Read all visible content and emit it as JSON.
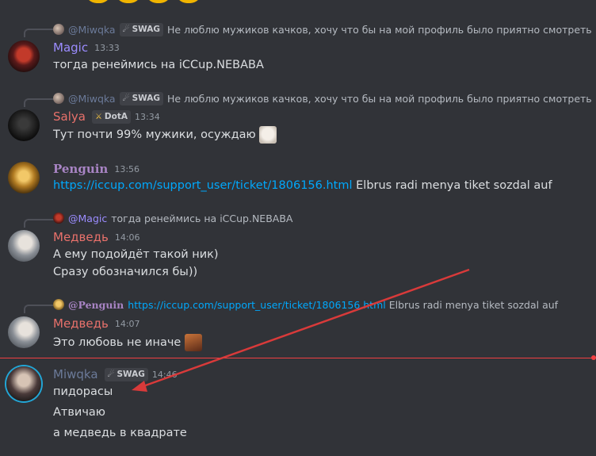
{
  "messages": [
    {
      "reply": {
        "author": "@Miwqka",
        "tag": "SWAG",
        "text": "Не люблю мужиков качков, хочу что бы на мой профиль было приятно смотреть"
      },
      "author": "Magic",
      "author_color": "#9b8cff",
      "time": "13:33",
      "lines": [
        "тогда ренеймись на iCCup.NEBABA"
      ]
    },
    {
      "reply": {
        "author": "@Miwqka",
        "tag": "SWAG",
        "text": "Не люблю мужиков качков, хочу что бы на мой профиль было приятно смотреть"
      },
      "author": "Salya",
      "author_color": "#e8716b",
      "tag": "DotA",
      "time": "13:34",
      "lines": [
        "Тут почти 99% мужики, осуждаю"
      ]
    },
    {
      "author": "Penguin",
      "author_color": "#a884c4",
      "time": "13:56",
      "link": "https://iccup.com/support_user/ticket/1806156.html",
      "lines": [
        "Elbrus radi menya tiket sozdal auf"
      ]
    },
    {
      "reply": {
        "author": "@Magic",
        "text": "тогда ренеймись на iCCup.NEBABA"
      },
      "author": "Медведь",
      "author_color": "#e8716b",
      "time": "14:06",
      "lines": [
        "А ему подойдёт такой ник)",
        "Сразу обозначился бы))"
      ]
    },
    {
      "reply": {
        "author": "@Penguin",
        "link": "https://iccup.com/support_user/ticket/1806156.html",
        "text": "Elbrus radi menya tiket sozdal auf"
      },
      "author": "Медведь",
      "author_color": "#e8716b",
      "time": "14:07",
      "lines": [
        "Это любовь не иначе"
      ]
    },
    {
      "author": "Miwqka",
      "author_color": "#6b7a99",
      "tag": "SWAG",
      "time": "14:46",
      "lines": [
        "пидорасы",
        "Атвичаю",
        "а медведь в квадрате"
      ]
    }
  ],
  "colors": {
    "background": "#313338",
    "link": "#00a8fc",
    "new_divider": "#f23f42",
    "arrow": "#d93a3a"
  }
}
